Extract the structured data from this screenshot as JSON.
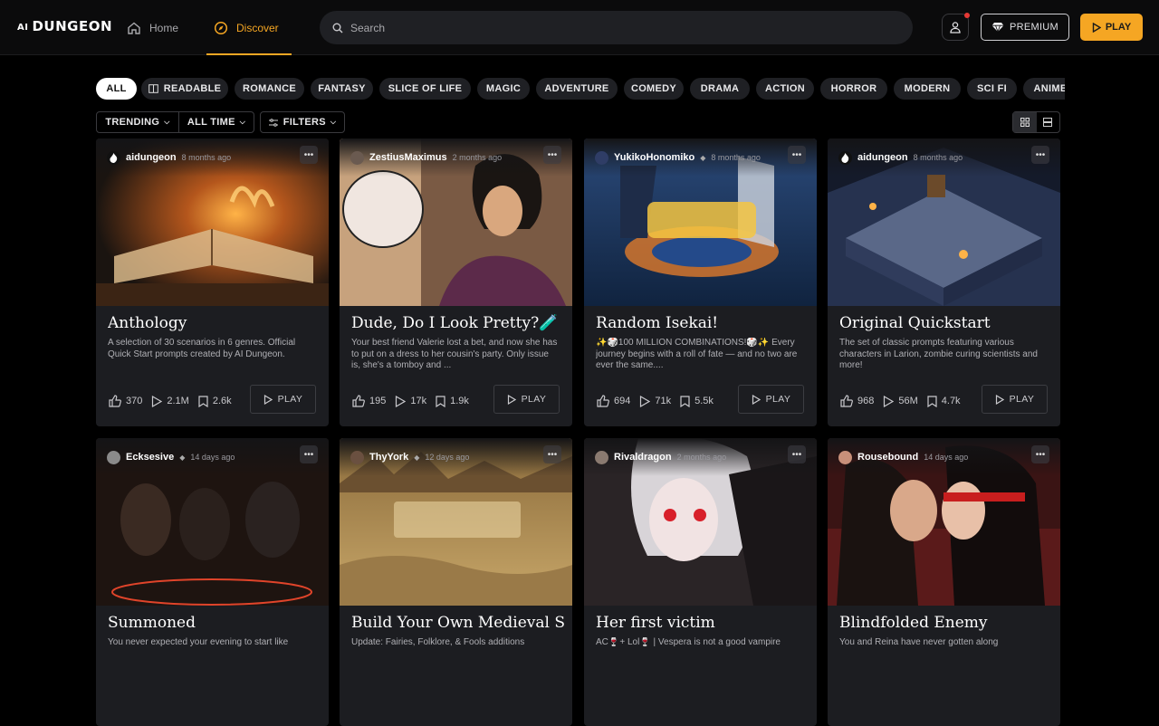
{
  "header": {
    "logo_small": "AI",
    "logo_main": "DUNGEON",
    "nav_home": "Home",
    "nav_discover": "Discover",
    "search_placeholder": "Search",
    "premium_label": "PREMIUM",
    "play_label": "PLAY",
    "accent_color": "#f5a623"
  },
  "chips": [
    {
      "label": "ALL",
      "active": true
    },
    {
      "label": "READABLE"
    },
    {
      "label": "ROMANCE"
    },
    {
      "label": "FANTASY"
    },
    {
      "label": "SLICE OF LIFE"
    },
    {
      "label": "MAGIC"
    },
    {
      "label": "ADVENTURE"
    },
    {
      "label": "COMEDY"
    },
    {
      "label": "DRAMA"
    },
    {
      "label": "ACTION"
    },
    {
      "label": "HORROR"
    },
    {
      "label": "MODERN"
    },
    {
      "label": "SCI FI"
    },
    {
      "label": "ANIME"
    }
  ],
  "filters": {
    "sort": "TRENDING",
    "time": "ALL TIME",
    "filters": "FILTERS"
  },
  "cards": [
    {
      "author": "aidungeon",
      "ago": "8 months ago",
      "verified": false,
      "title": "Anthology",
      "desc": "A selection of 30 scenarios in 6 genres. Official Quick Start prompts created by AI Dungeon.",
      "likes": "370",
      "plays": "2.1M",
      "saves": "2.6k",
      "play": "PLAY"
    },
    {
      "author": "ZestiusMaximus",
      "ago": "2 months ago",
      "verified": false,
      "title": "Dude, Do I Look Pretty?🧪",
      "desc": "Your best friend Valerie lost a bet, and now she has to put on a dress to her cousin's party. Only issue is, she's a tomboy and ...",
      "likes": "195",
      "plays": "17k",
      "saves": "1.9k",
      "play": "PLAY"
    },
    {
      "author": "YukikoHonomiko",
      "ago": "8 months ago",
      "verified": true,
      "title": "Random Isekai!",
      "desc": "✨🎲100 MILLION COMBINATIONS!🎲✨ Every journey begins with a roll of fate — and no two are ever the same....",
      "likes": "694",
      "plays": "71k",
      "saves": "5.5k",
      "play": "PLAY"
    },
    {
      "author": "aidungeon",
      "ago": "8 months ago",
      "verified": false,
      "title": "Original Quickstart",
      "desc": "The set of classic prompts featuring various characters in Larion, zombie curing scientists and more!",
      "likes": "968",
      "plays": "56M",
      "saves": "4.7k",
      "play": "PLAY"
    },
    {
      "author": "Ecksesive",
      "ago": "14 days ago",
      "verified": true,
      "title": "Summoned",
      "desc": "You never expected your evening to start like",
      "likes": "",
      "plays": "",
      "saves": "",
      "play": ""
    },
    {
      "author": "ThyYork",
      "ago": "12 days ago",
      "verified": true,
      "title": "Build Your Own Medieval S...",
      "desc": "Update: Fairies, Folklore, & Fools additions",
      "likes": "",
      "plays": "",
      "saves": "",
      "play": ""
    },
    {
      "author": "Rivaldragon",
      "ago": "2 months ago",
      "verified": false,
      "title": "Her first victim",
      "desc": "AC🍷+ Lol🍷 | Vespera is not a good vampire",
      "likes": "",
      "plays": "",
      "saves": "",
      "play": ""
    },
    {
      "author": "Rousebound",
      "ago": "14 days ago",
      "verified": false,
      "title": "Blindfolded Enemy",
      "desc": "You and Reina have never gotten along",
      "likes": "",
      "plays": "",
      "saves": "",
      "play": ""
    }
  ]
}
